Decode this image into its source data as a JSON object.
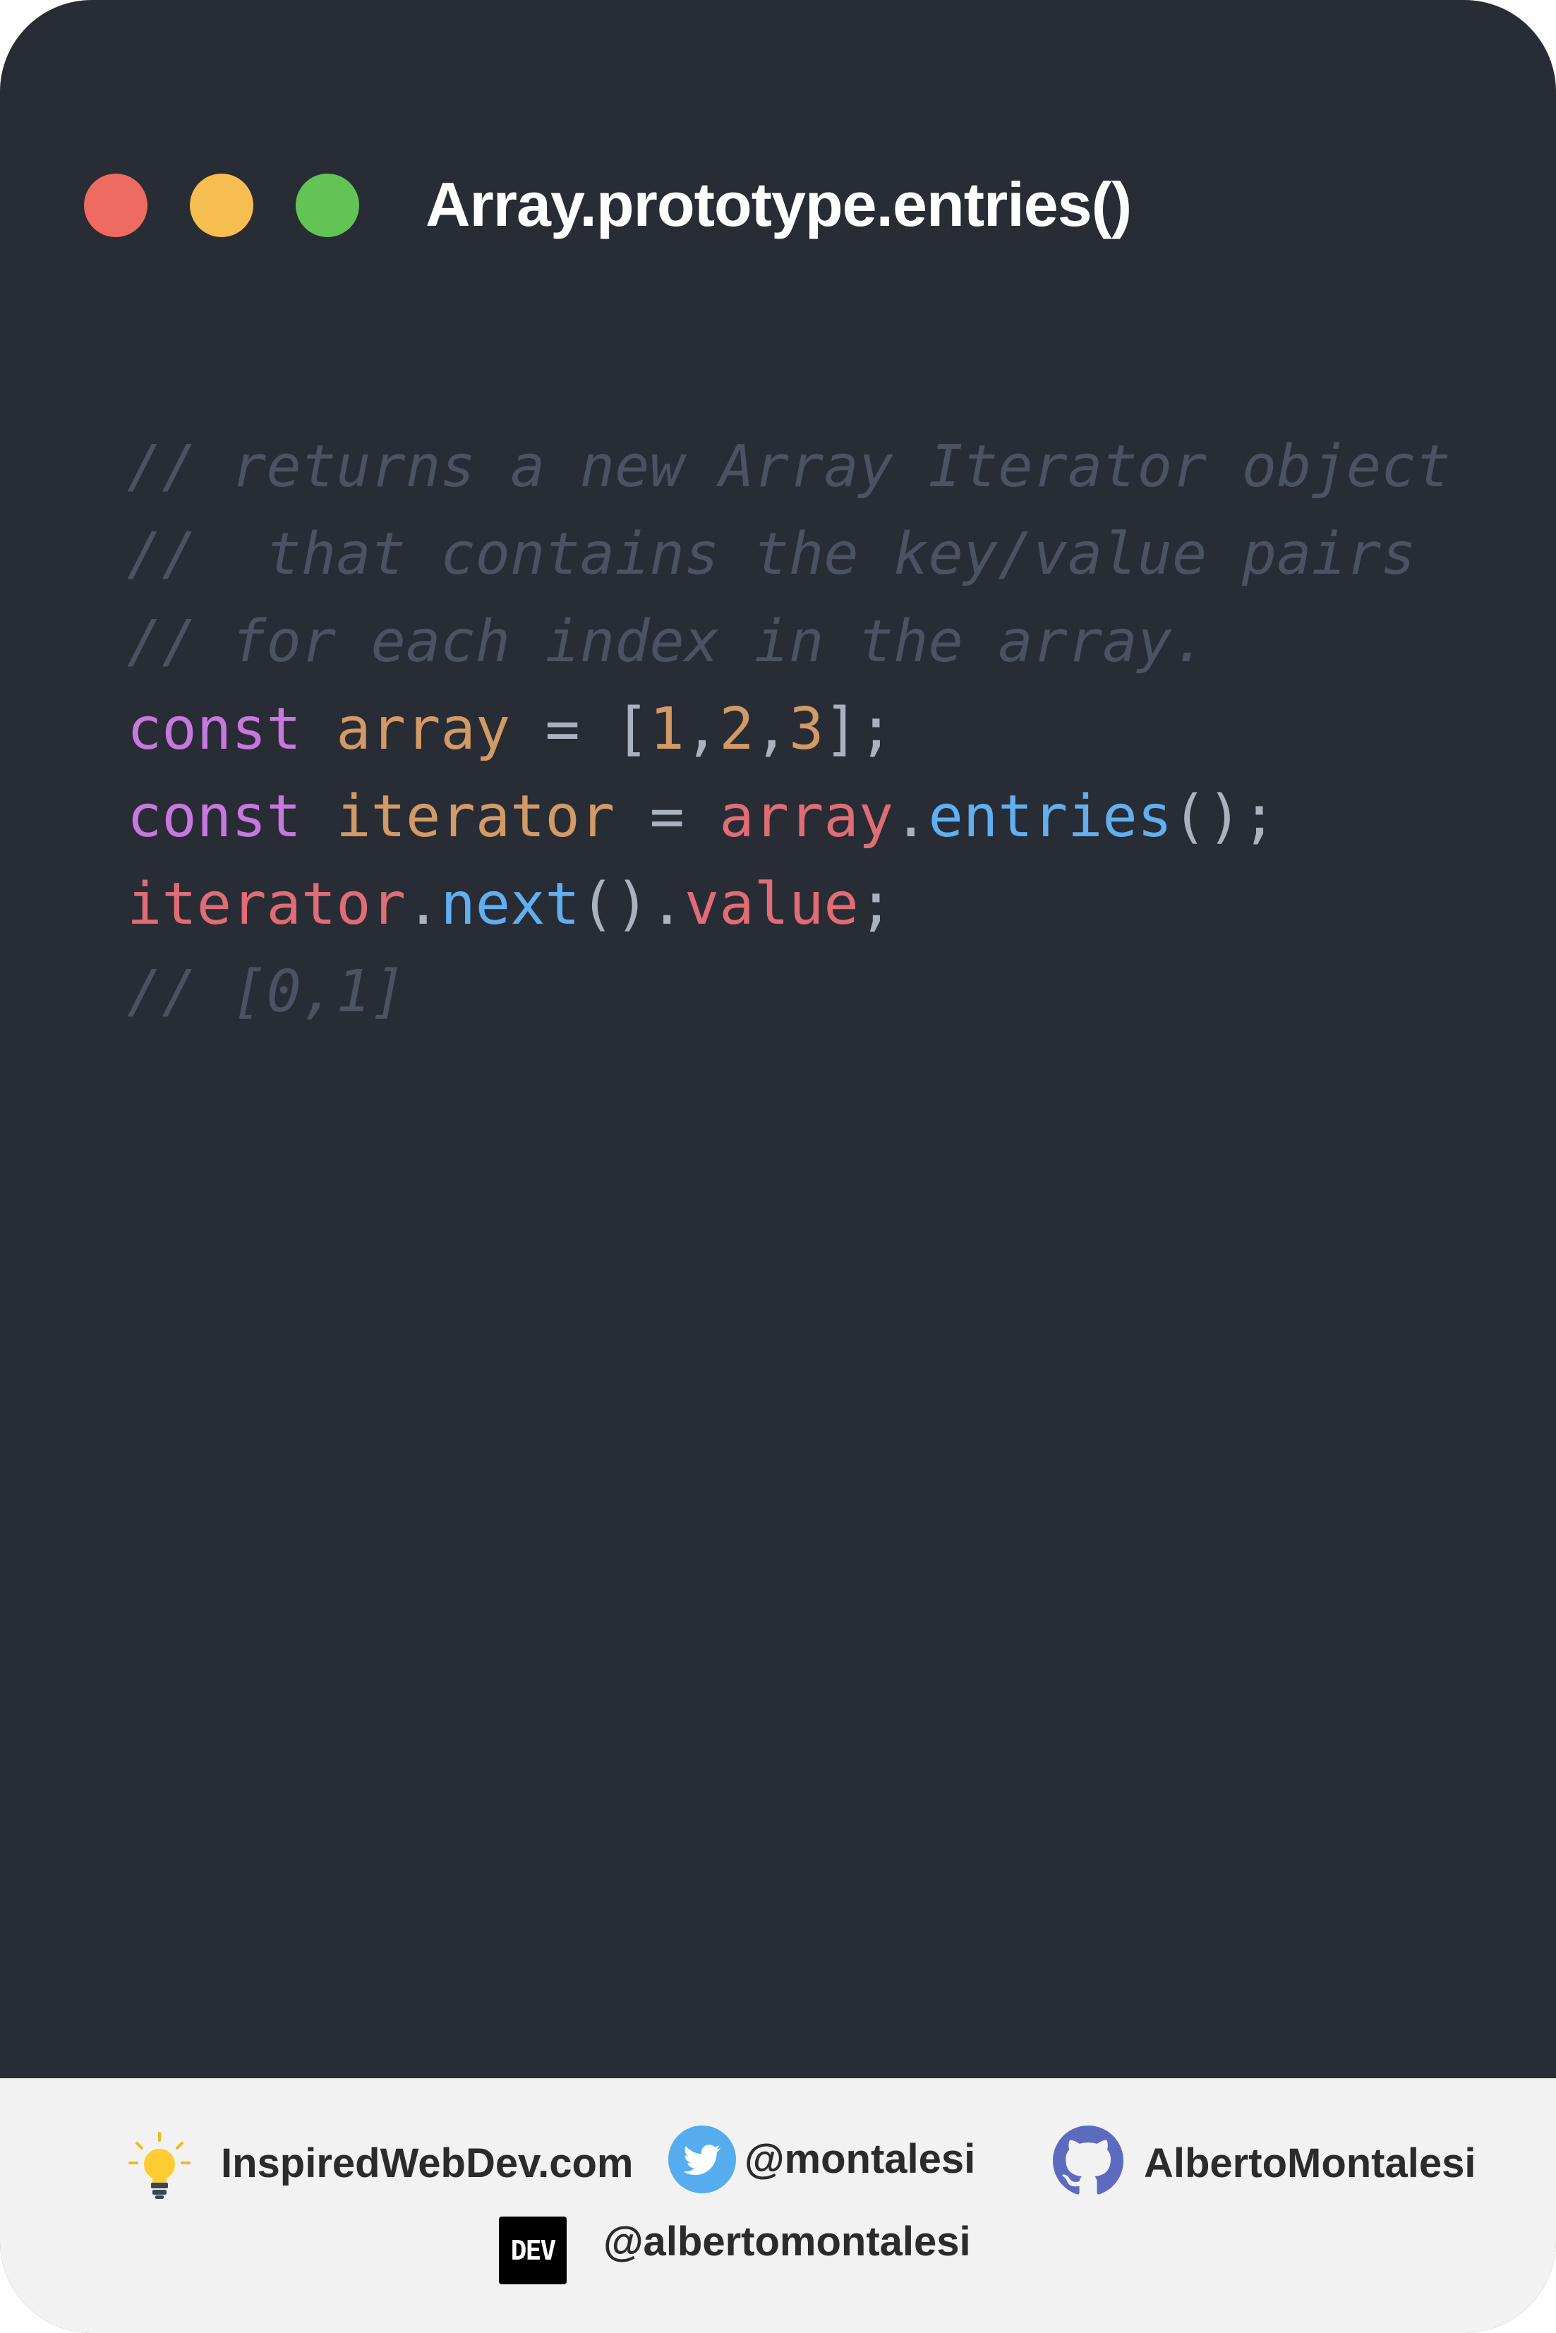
{
  "window": {
    "title": "Array.prototype.entries()",
    "controls": [
      {
        "name": "close-dot",
        "color": "#ed6b60"
      },
      {
        "name": "minimize-dot",
        "color": "#f6be50"
      },
      {
        "name": "maximize-dot",
        "color": "#62c454"
      }
    ]
  },
  "code": {
    "lines": [
      [
        {
          "text": "// returns a new Array Iterator object",
          "color": "#4b5261",
          "kind": "comment"
        }
      ],
      [
        {
          "text": "//  that contains the key/value pairs",
          "color": "#4b5261",
          "kind": "comment"
        }
      ],
      [
        {
          "text": "// for each index in the array.",
          "color": "#4b5261",
          "kind": "comment"
        }
      ],
      [
        {
          "text": "const",
          "color": "#c678dd"
        },
        {
          "text": " ",
          "color": "#abb2bf"
        },
        {
          "text": "array",
          "color": "#d19a66"
        },
        {
          "text": " = [",
          "color": "#abb2bf"
        },
        {
          "text": "1",
          "color": "#d19a66"
        },
        {
          "text": ",",
          "color": "#abb2bf"
        },
        {
          "text": "2",
          "color": "#d19a66"
        },
        {
          "text": ",",
          "color": "#abb2bf"
        },
        {
          "text": "3",
          "color": "#d19a66"
        },
        {
          "text": "];",
          "color": "#abb2bf"
        }
      ],
      [
        {
          "text": "const",
          "color": "#c678dd"
        },
        {
          "text": " ",
          "color": "#abb2bf"
        },
        {
          "text": "iterator",
          "color": "#d19a66"
        },
        {
          "text": " = ",
          "color": "#abb2bf"
        },
        {
          "text": "array",
          "color": "#e06c75"
        },
        {
          "text": ".",
          "color": "#abb2bf"
        },
        {
          "text": "entries",
          "color": "#61afef"
        },
        {
          "text": "();",
          "color": "#abb2bf"
        }
      ],
      [
        {
          "text": "iterator",
          "color": "#e06c75"
        },
        {
          "text": ".",
          "color": "#abb2bf"
        },
        {
          "text": "next",
          "color": "#61afef"
        },
        {
          "text": "().",
          "color": "#abb2bf"
        },
        {
          "text": "value",
          "color": "#e06c75"
        },
        {
          "text": ";",
          "color": "#abb2bf"
        }
      ],
      [
        {
          "text": "// [0,1]",
          "color": "#4b5261",
          "kind": "comment"
        }
      ]
    ]
  },
  "footer": {
    "website": "InspiredWebDev.com",
    "twitter": "@montalesi",
    "github": "AlbertoMontalesi",
    "dev": "@albertomontalesi",
    "dev_logo_text": "DEV",
    "icons": {
      "website": "lightbulb-icon",
      "twitter": "twitter-icon",
      "github": "github-icon",
      "dev": "dev-logo-icon"
    },
    "colors": {
      "twitter": "#55acee",
      "github": "#5c6bc0",
      "bulb": "#ffcc33"
    }
  }
}
